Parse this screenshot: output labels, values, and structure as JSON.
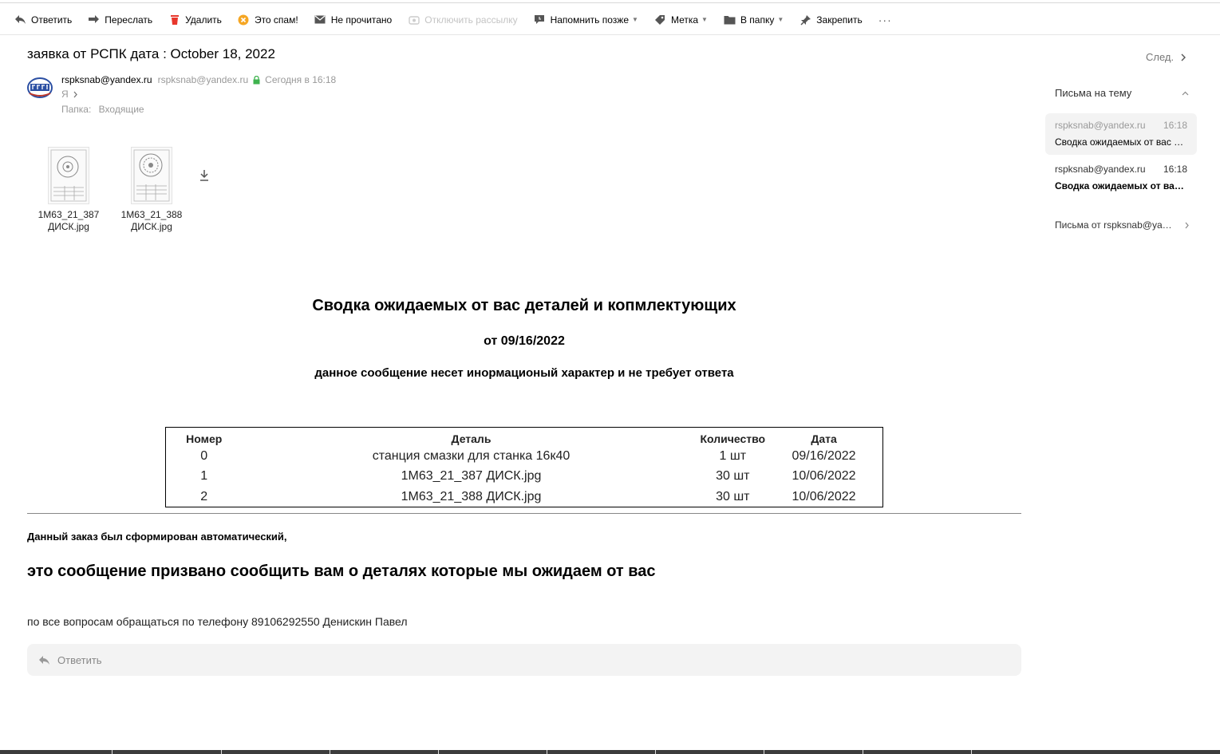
{
  "toolbar": {
    "reply": "Ответить",
    "forward": "Переслать",
    "delete": "Удалить",
    "spam": "Это спам!",
    "unread": "Не прочитано",
    "unsubscribe": "Отключить рассылку",
    "remind": "Напомнить позже",
    "label": "Метка",
    "folder": "В папку",
    "pin": "Закрепить",
    "more": "···"
  },
  "message": {
    "subject": "заявка от РСПК дата : October 18, 2022",
    "next": "След.",
    "sender_name": "rspksnab@yandex.ru",
    "sender_email": "rspksnab@yandex.ru",
    "date": "Сегодня в 16:18",
    "recipient": "Я",
    "folder_label": "Папка:",
    "folder_name": "Входящие"
  },
  "attachments": [
    {
      "line1": "1М63_21_387",
      "line2": "ДИСК.jpg"
    },
    {
      "line1": "1М63_21_388",
      "line2": "ДИСК.jpg"
    }
  ],
  "body": {
    "title": "Сводка ожидаемых от вас деталей и копмлектующих",
    "date_line": "от 09/16/2022",
    "notice": "данное сообщение несет инормационый характер и не требует ответа",
    "table": {
      "headers": [
        "Номер",
        "Деталь",
        "Количество",
        "Дата"
      ],
      "rows": [
        [
          "0",
          "станция смазки для станка 16к40",
          "1 шт",
          "09/16/2022"
        ],
        [
          "1",
          "1М63_21_387 ДИСК.jpg",
          "30 шт",
          "10/06/2022"
        ],
        [
          "2",
          "1М63_21_388 ДИСК.jpg",
          "30 шт",
          "10/06/2022"
        ]
      ]
    },
    "footer1": "Данный заказ был сформирован автоматический,",
    "footer2": "это сообщение призвано сообщить вам о деталях которые мы ожидаем от вас",
    "footer3": "по все вопросам обращаться по телефону 89106292550 Денискин Павел"
  },
  "reply_box": {
    "label": "Ответить"
  },
  "sidebar": {
    "thread_heading": "Письма на тему",
    "threads": [
      {
        "from": "rspksnab@yandex.ru",
        "time": "16:18",
        "subject": "Сводка ожидаемых от вас деталей и копмлектующих"
      },
      {
        "from": "rspksnab@yandex.ru",
        "time": "16:18",
        "subject": "Сводка ожидаемых от вас деталей и копмлектующих"
      }
    ],
    "from_sender": "Письма от rspksnab@yandex.ru"
  },
  "colors": {
    "accent_green": "#3fb34f",
    "spam_orange": "#f5a623",
    "delete_red": "#e8372c"
  }
}
